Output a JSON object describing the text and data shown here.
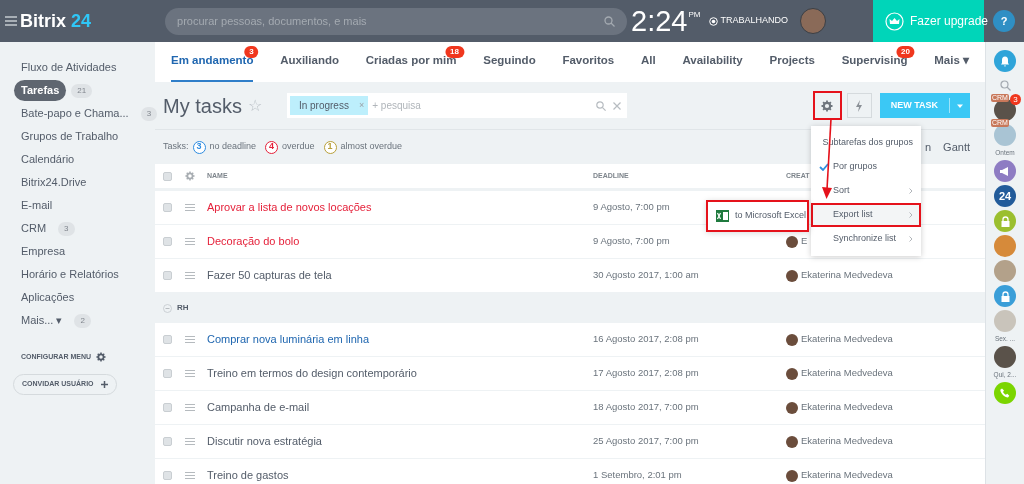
{
  "top_bar": {
    "logo": {
      "name": "Bitrix",
      "number": "24"
    },
    "search": {
      "placeholder": "procurar pessoas, documentos, e mais"
    },
    "clock": {
      "time": "2:24",
      "meridiem": "PM"
    },
    "work_status": "TRABALHANDO",
    "upgrade": "Fazer upgrade",
    "help": "?"
  },
  "sidebar": {
    "items": [
      {
        "label": "Fluxo de Atividades",
        "selected": false
      },
      {
        "label": "Tarefas",
        "selected": true,
        "count": "21"
      },
      {
        "label": "Bate-papo e Chama...",
        "selected": false,
        "count": "3"
      },
      {
        "label": "Grupos de Trabalho",
        "selected": false
      },
      {
        "label": "Calendário",
        "selected": false
      },
      {
        "label": "Bitrix24.Drive",
        "selected": false
      },
      {
        "label": "E-mail",
        "selected": false
      },
      {
        "label": "CRM",
        "selected": false,
        "count": "3"
      },
      {
        "label": "Empresa",
        "selected": false
      },
      {
        "label": "Horário e Relatórios",
        "selected": false
      },
      {
        "label": "Aplicações",
        "selected": false
      },
      {
        "label": "Mais... ▾",
        "selected": false,
        "count": "2"
      }
    ],
    "configure": "CONFIGURAR MENU",
    "invite": "CONVIDAR USUÁRIO"
  },
  "tabs": [
    {
      "label": "Em andamento",
      "selected": true,
      "badge": "3"
    },
    {
      "label": "Auxiliando",
      "selected": false
    },
    {
      "label": "Criadas por mim",
      "selected": false,
      "badge": "18"
    },
    {
      "label": "Seguindo",
      "selected": false
    },
    {
      "label": "Favoritos",
      "selected": false
    },
    {
      "label": "All",
      "selected": false
    },
    {
      "label": "Availability",
      "selected": false
    },
    {
      "label": "Projects",
      "selected": false
    },
    {
      "label": "Supervising",
      "selected": false,
      "badge": "20"
    },
    {
      "label": "Mais ▾",
      "selected": false
    }
  ],
  "header": {
    "title": "My tasks",
    "star": "☆",
    "filter": {
      "tag": "In progress",
      "remove": "×",
      "placeholder": "+ pesquisa"
    },
    "settings_highlighted": true,
    "new_task": "NEW TASK"
  },
  "counters": {
    "label": "Tasks:",
    "items": [
      {
        "count": "3",
        "label": "no deadline",
        "color": "#2d8ce0"
      },
      {
        "count": "4",
        "label": "overdue",
        "color": "#e5213a"
      },
      {
        "count": "1",
        "label": "almost overdue",
        "color": "#b8a03a"
      }
    ],
    "views": [
      "n",
      "Gantt"
    ]
  },
  "table": {
    "columns": [
      "NAME",
      "DEADLINE",
      "CREAT"
    ],
    "header_checked": false,
    "rows": [
      {
        "kind": "task",
        "name": "Aprovar a lista de novos locações",
        "color": "#e5213a",
        "deadline": "9 Agosto, 7:00 pm",
        "checked": false
      },
      {
        "kind": "task",
        "name": "Decoração do bolo",
        "color": "#e5213a",
        "deadline": "9 Agosto, 7:00 pm",
        "creator": "E",
        "checked": false
      },
      {
        "kind": "task",
        "name": "Fazer 50 capturas de tela",
        "color": "#535c69",
        "deadline": "30 Agosto 2017, 1:00 am",
        "creator": "Ekaterina Medvedeva",
        "checked": false
      },
      {
        "kind": "group",
        "name": "RH",
        "expanded": true
      },
      {
        "kind": "task",
        "name": "Comprar nova luminária em linha",
        "color": "#2067b0",
        "deadline": "16 Agosto 2017, 2:08 pm",
        "creator": "Ekaterina Medvedeva",
        "checked": false
      },
      {
        "kind": "task",
        "name": "Treino em termos do design contemporário",
        "color": "#535c69",
        "deadline": "17 Agosto 2017, 2:08 pm",
        "creator": "Ekaterina Medvedeva",
        "checked": false
      },
      {
        "kind": "task",
        "name": "Campanha de e-mail",
        "color": "#535c69",
        "deadline": "18 Agosto 2017, 7:00 pm",
        "creator": "Ekaterina Medvedeva",
        "checked": false
      },
      {
        "kind": "task",
        "name": "Discutir nova estratégia",
        "color": "#535c69",
        "deadline": "25 Agosto 2017, 7:00 pm",
        "creator": "Ekaterina Medvedeva",
        "checked": false
      },
      {
        "kind": "task",
        "name": "Treino de gastos",
        "color": "#535c69",
        "deadline": "1 Setembro, 2:01 pm",
        "creator": "Ekaterina Medvedeva",
        "checked": false
      }
    ]
  },
  "settings_menu": {
    "items": [
      {
        "label": "Subtarefas dos grupos",
        "checked": false,
        "submenu": false,
        "highlighted": false
      },
      {
        "label": "Por grupos",
        "checked": true,
        "submenu": false,
        "highlighted": false
      },
      {
        "label": "Sort",
        "checked": false,
        "submenu": true,
        "highlighted": false
      },
      {
        "label": "Export list",
        "checked": false,
        "submenu": true,
        "highlighted": true
      },
      {
        "label": "Synchronize list",
        "checked": false,
        "submenu": true,
        "highlighted": false
      }
    ]
  },
  "export_submenu": {
    "items": [
      {
        "label": "to Microsoft Excel",
        "highlighted": true
      }
    ]
  },
  "right_bar": {
    "items": [
      {
        "kind": "bell",
        "color": "#2fa4d9"
      },
      {
        "kind": "search"
      },
      {
        "kind": "avatar",
        "badge": "CRM",
        "count": "3"
      },
      {
        "kind": "avatar",
        "badge": "CRM"
      },
      {
        "kind": "caption",
        "text": "Ontem"
      },
      {
        "kind": "megaphone",
        "color": "#8e7cc3"
      },
      {
        "kind": "logo24",
        "color": "#225b9a",
        "text": "24"
      },
      {
        "kind": "lock",
        "color": "#9bbf2f"
      },
      {
        "kind": "avatar"
      },
      {
        "kind": "avatar"
      },
      {
        "kind": "lock",
        "color": "#3a9ed8"
      },
      {
        "kind": "avatar"
      },
      {
        "kind": "caption",
        "text": "Sex. ..."
      },
      {
        "kind": "avatar"
      },
      {
        "kind": "caption",
        "text": "Qui, 2..."
      },
      {
        "kind": "phone",
        "color": "#7bd500"
      }
    ]
  }
}
